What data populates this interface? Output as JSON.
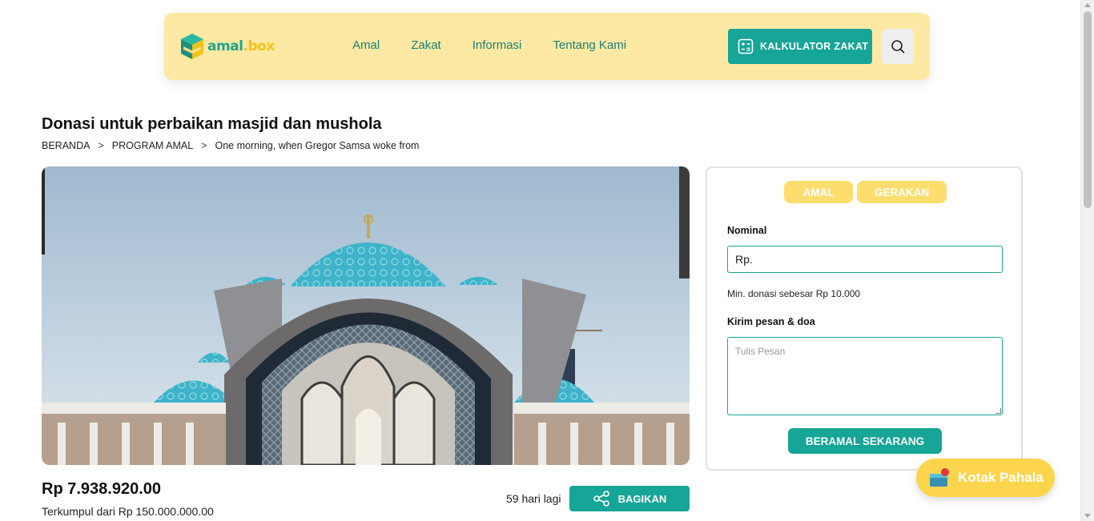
{
  "brand": {
    "name_part1": "amal",
    "name_part2": "box",
    "logo_icon": "cube-icon"
  },
  "nav": {
    "items": [
      {
        "label": "Amal"
      },
      {
        "label": "Zakat"
      },
      {
        "label": "Informasi"
      },
      {
        "label": "Tentang Kami"
      }
    ],
    "calculator_label": "KALKULATOR ZAKAT",
    "calculator_icon": "calculator-icon",
    "search_icon": "search-icon"
  },
  "page": {
    "title": "Donasi untuk perbaikan masjid dan mushola",
    "breadcrumb": [
      "BERANDA",
      "PROGRAM AMAL",
      "One morning, when Gregor Samsa woke from"
    ],
    "breadcrumb_separator": ">"
  },
  "campaign": {
    "image_alt_icon": "mosque-photo",
    "amount": "Rp 7.938.920.00",
    "collected_text": "Terkumpul dari Rp 150.000.000.00",
    "days_left": "59 hari lagi",
    "share_label": "BAGIKAN",
    "share_icon": "share-icon"
  },
  "donation_form": {
    "tabs": [
      "AMAL",
      "GERAKAN"
    ],
    "nominal_label": "Nominal",
    "nominal_value": "Rp.",
    "min_note": "Min. donasi sebesar Rp 10.000",
    "message_label": "Kirim pesan & doa",
    "message_placeholder": "Tulis Pesan",
    "submit_label": "BERAMAL SEKARANG"
  },
  "floating": {
    "label": "Kotak Pahala",
    "icon": "gift-box-icon"
  },
  "colors": {
    "primary": "#16a596",
    "accent": "#fddd6e",
    "navbar_bg": "#fde9a3"
  }
}
